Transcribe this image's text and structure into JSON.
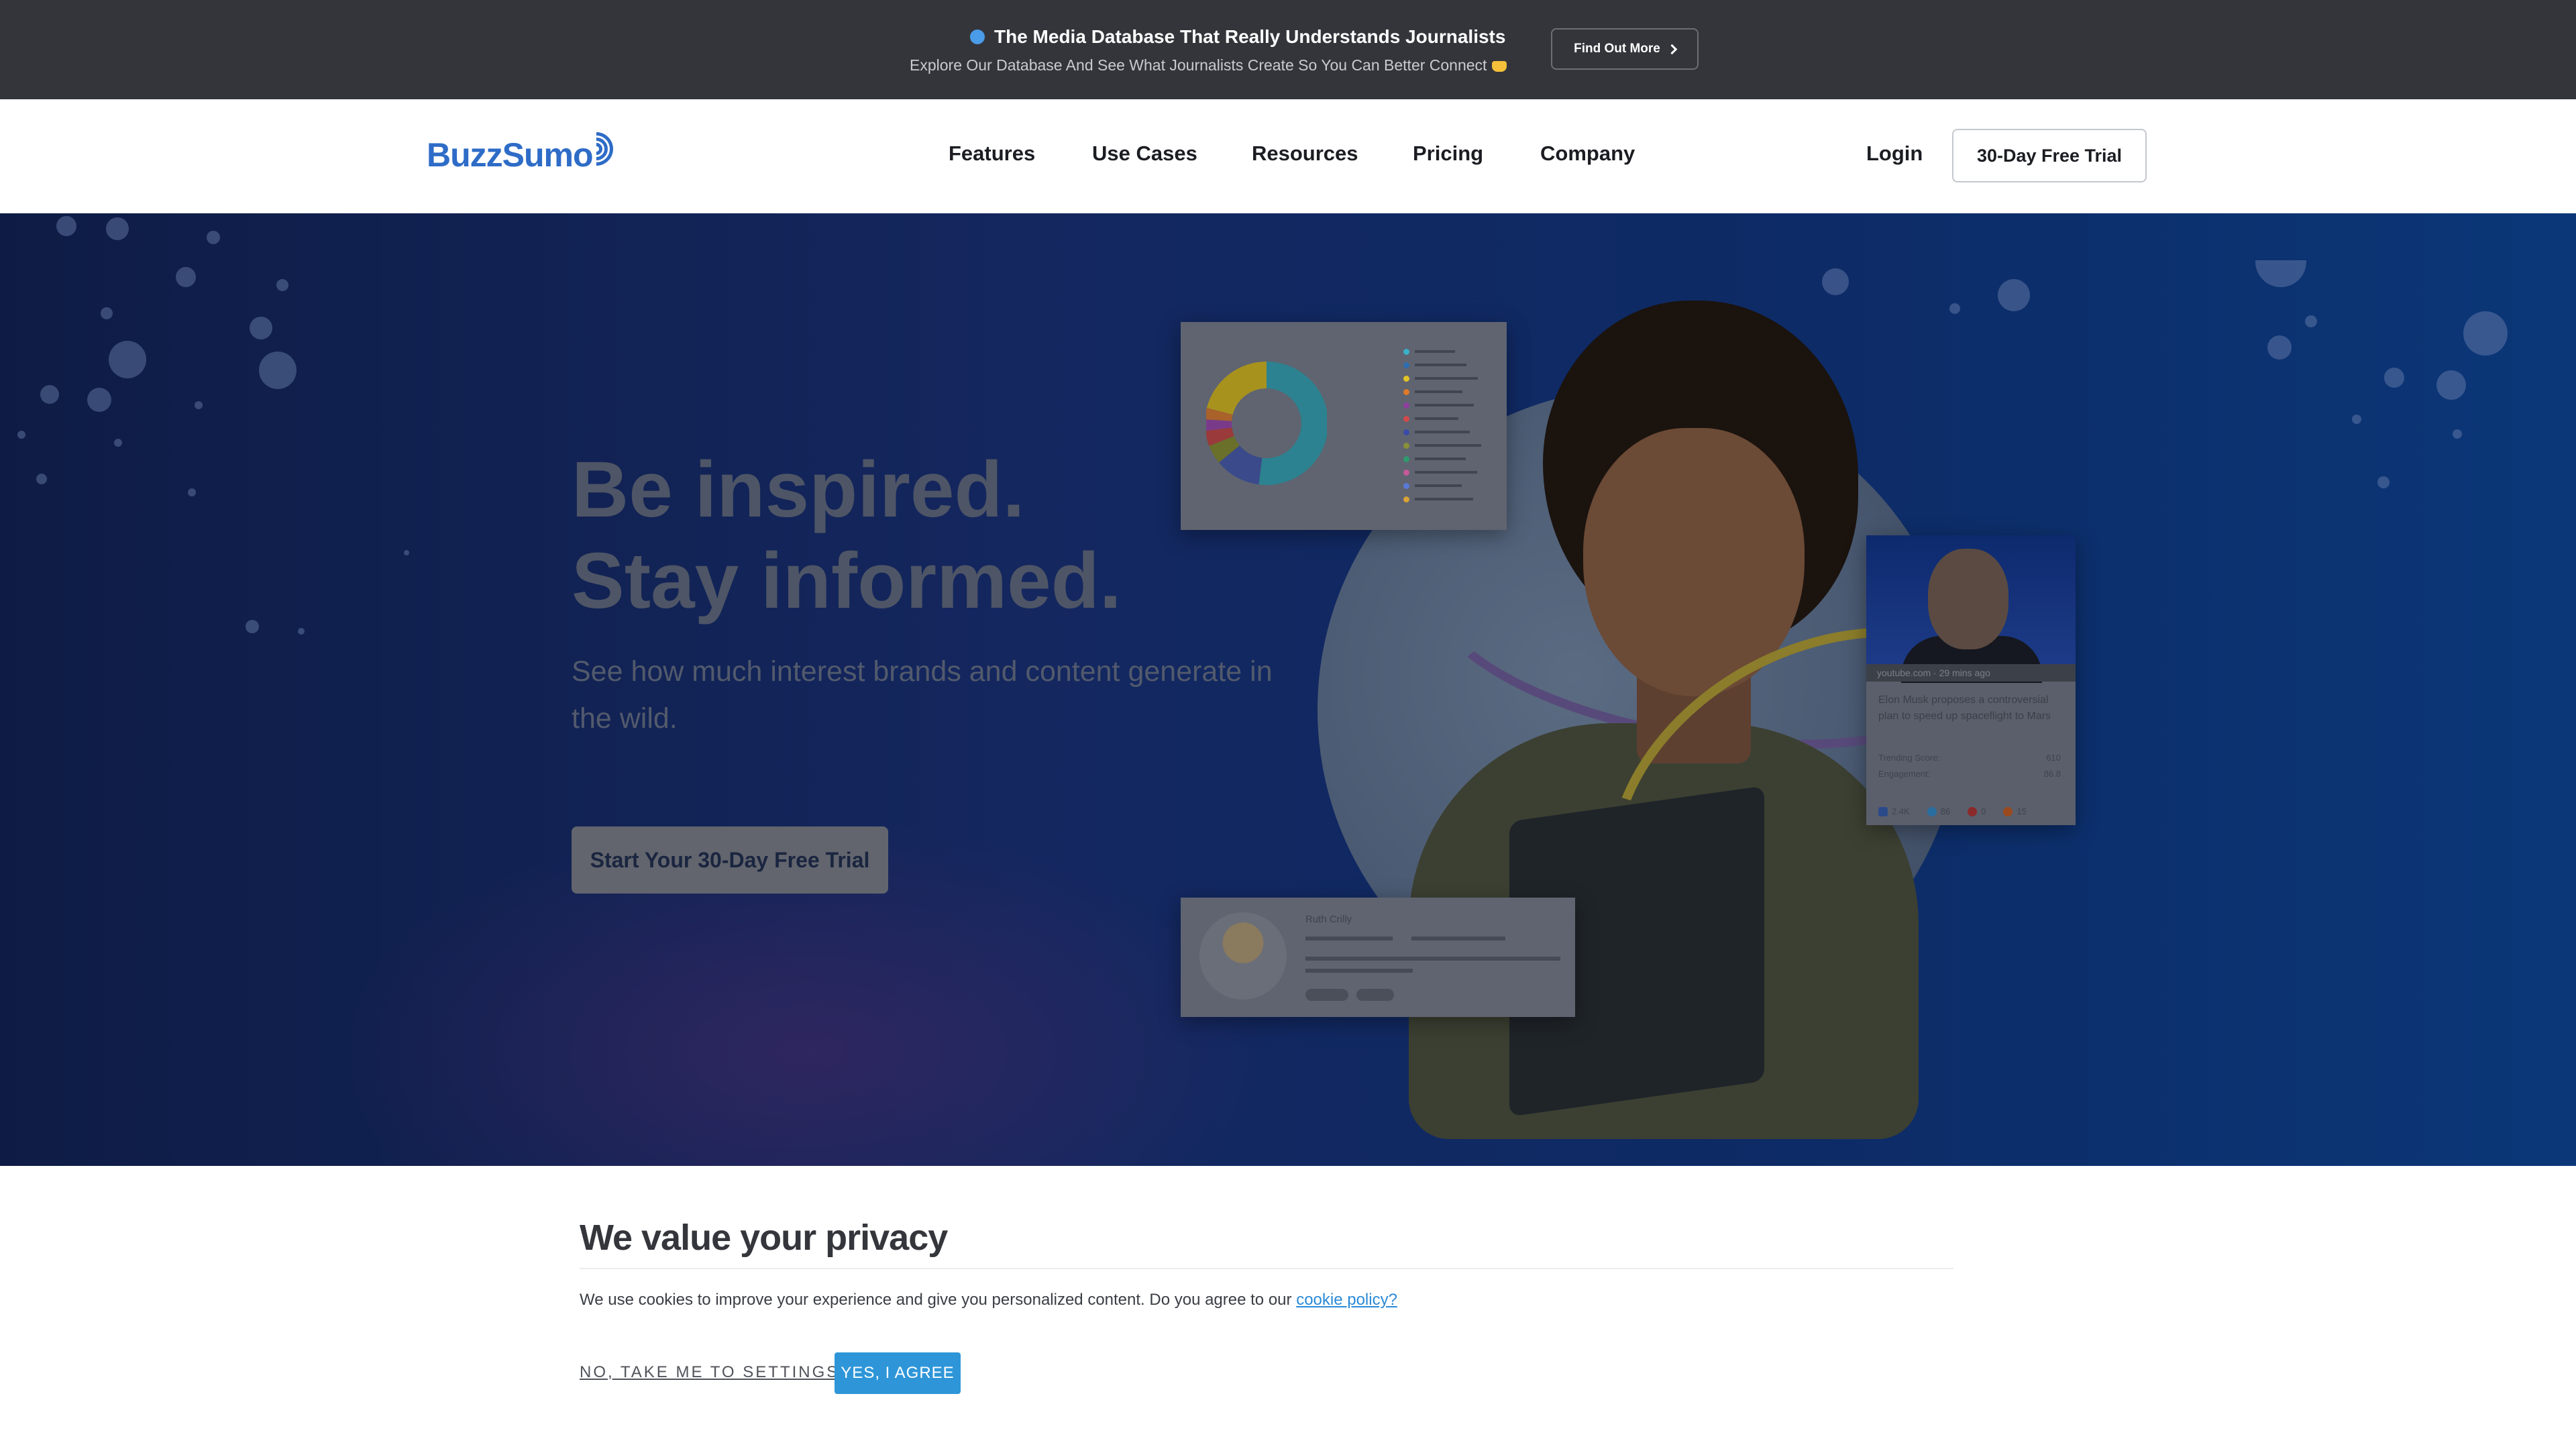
{
  "announcement": {
    "title": "The Media Database That Really Understands Journalists",
    "subtitle": "Explore Our Database And See What Journalists Create So You Can Better Connect",
    "button_label": "Find Out More",
    "dot_color": "#4a9be8"
  },
  "nav": {
    "logo_text": "BuzzSumo",
    "items": [
      {
        "label": "Features"
      },
      {
        "label": "Use Cases"
      },
      {
        "label": "Resources"
      },
      {
        "label": "Pricing"
      },
      {
        "label": "Company"
      }
    ],
    "login_label": "Login",
    "trial_label": "30-Day Free Trial",
    "brand_color": "#2e6cc7"
  },
  "hero": {
    "title_line1": "Be inspired.",
    "title_line2": "Stay informed.",
    "subtitle": "See how much interest brands and content generate in the wild.",
    "cta_label": "Start Your 30-Day Free Trial",
    "donut_card": {
      "legend": [
        {
          "color": "#3ab0c8"
        },
        {
          "color": "#2d6eb0"
        },
        {
          "color": "#e3c227"
        },
        {
          "color": "#e07a27"
        },
        {
          "color": "#8e3fa0"
        },
        {
          "color": "#d04a4a"
        },
        {
          "color": "#3a4aa8"
        },
        {
          "color": "#8a8f3a"
        },
        {
          "color": "#2e9a6e"
        },
        {
          "color": "#c45a9a"
        },
        {
          "color": "#5a7ad8"
        },
        {
          "color": "#d9a238"
        }
      ],
      "segments": [
        {
          "value": 52,
          "color": "#2c8290"
        },
        {
          "value": 12,
          "color": "#3a4a8a"
        },
        {
          "value": 5,
          "color": "#6a6f2a"
        },
        {
          "value": 4,
          "color": "#9a3a3a"
        },
        {
          "value": 3,
          "color": "#7a3a8a"
        },
        {
          "value": 3,
          "color": "#a8622a"
        },
        {
          "value": 21,
          "color": "#a8921e"
        }
      ]
    },
    "elon_card": {
      "source": "youtube.com · 29 mins ago",
      "title": "Elon Musk proposes a controversial plan to speed up spaceflight to Mars",
      "trending_label": "Trending Score:",
      "trending_value": "610",
      "engagement_label": "Engagement:",
      "engagement_value": "86.8",
      "facebook": "2.4K",
      "twitter": "86",
      "pinterest": "0",
      "reddit": "15"
    },
    "influencer_card": {
      "name": "Ruth Crilly"
    }
  },
  "privacy": {
    "title": "We value your privacy",
    "text": "We use cookies to improve your experience and give you personalized content. Do you agree to our",
    "link_label": "cookie policy?",
    "decline_label": "NO, TAKE ME TO SETTINGS",
    "accept_label": "YES, I AGREE",
    "accept_color": "#2e96d8"
  }
}
